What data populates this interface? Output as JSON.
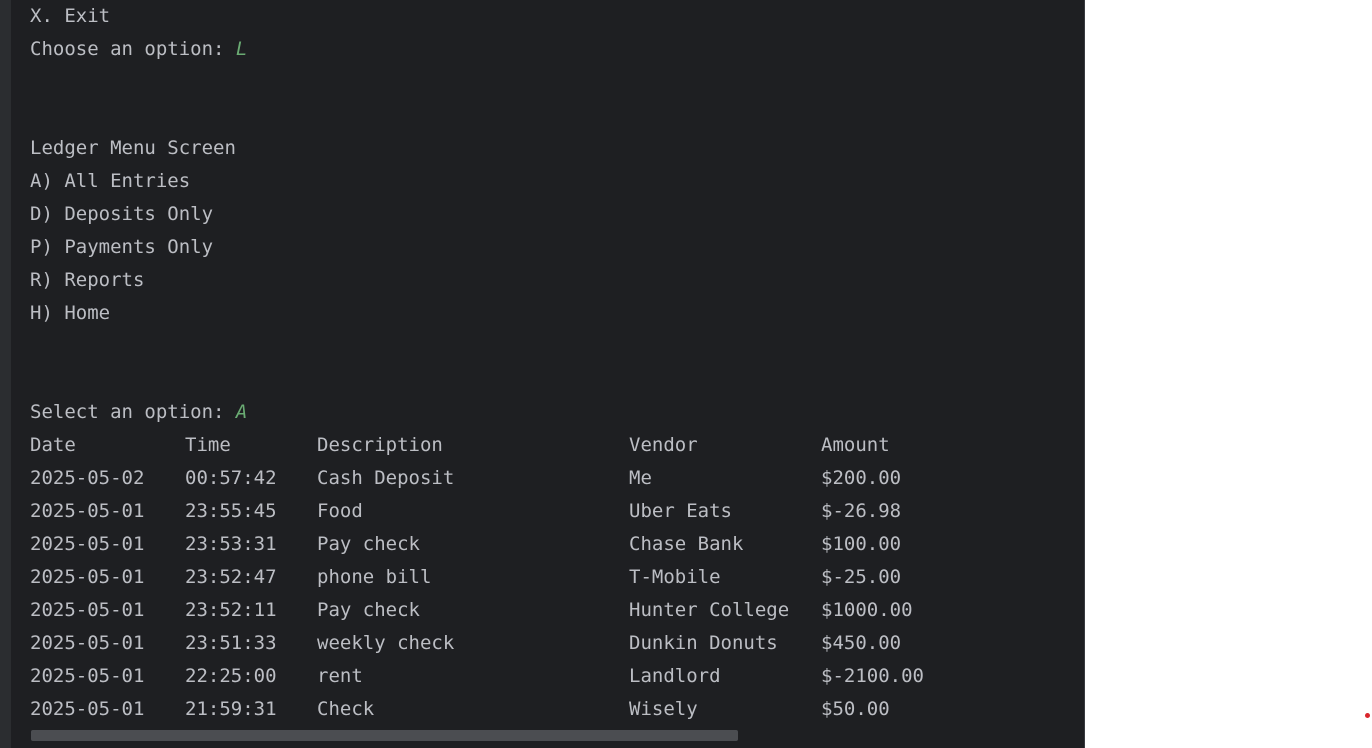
{
  "console": {
    "lines": {
      "exit": "X. Exit",
      "choose_prompt": "Choose an option: ",
      "choose_value": "L",
      "ledger_title": "Ledger Menu Screen",
      "opt_all": "A) All Entries",
      "opt_deposits": "D) Deposits Only",
      "opt_payments": "P) Payments Only",
      "opt_reports": "R) Reports",
      "opt_home": "H) Home",
      "select_prompt": "Select an option: ",
      "select_value": "A"
    },
    "table": {
      "headers": {
        "date": "Date",
        "time": "Time",
        "description": "Description",
        "vendor": "Vendor",
        "amount": "Amount"
      },
      "rows": [
        {
          "date": "2025-05-02",
          "time": "00:57:42",
          "description": "Cash Deposit",
          "vendor": "Me",
          "amount": "$200.00"
        },
        {
          "date": "2025-05-01",
          "time": "23:55:45",
          "description": "Food",
          "vendor": "Uber Eats",
          "amount": "$-26.98"
        },
        {
          "date": "2025-05-01",
          "time": "23:53:31",
          "description": "Pay check",
          "vendor": "Chase Bank",
          "amount": "$100.00"
        },
        {
          "date": "2025-05-01",
          "time": "23:52:47",
          "description": "phone bill",
          "vendor": "T-Mobile",
          "amount": "$-25.00"
        },
        {
          "date": "2025-05-01",
          "time": "23:52:11",
          "description": "Pay check",
          "vendor": "Hunter College",
          "amount": "$1000.00"
        },
        {
          "date": "2025-05-01",
          "time": "23:51:33",
          "description": "weekly check",
          "vendor": "Dunkin Donuts",
          "amount": "$450.00"
        },
        {
          "date": "2025-05-01",
          "time": "22:25:00",
          "description": "rent",
          "vendor": "Landlord",
          "amount": "$-2100.00"
        },
        {
          "date": "2025-05-01",
          "time": "21:59:31",
          "description": "Check",
          "vendor": "Wisely",
          "amount": "$50.00"
        }
      ]
    }
  },
  "colors": {
    "console_bg": "#1e1f22",
    "text": "#bcbec4",
    "user_input": "#6aab73"
  }
}
